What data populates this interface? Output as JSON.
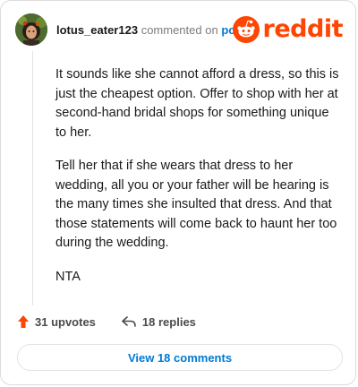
{
  "comment": {
    "username": "lotus_eater123",
    "action_text": "commented on",
    "target_link": "post",
    "paragraphs": [
      "It sounds like she cannot afford a dress, so this is just the cheapest option. Offer to shop with her at second-hand bridal shops for something unique to her.",
      "Tell her that if she wears that dress to her wedding, all you or your father will be hearing is the many times she insulted that dress. And that those statements will come back to haunt her too during the wedding.",
      "NTA"
    ]
  },
  "brand": {
    "wordmark": "reddit",
    "color": "#ff4500"
  },
  "actions": {
    "upvotes_label": "31 upvotes",
    "replies_label": "18 replies"
  },
  "view_button": {
    "label": "View 18 comments"
  },
  "icons": {
    "avatar": "user-avatar",
    "logo": "reddit-snoo-icon",
    "upvote": "upvote-arrow-icon",
    "reply": "reply-arrow-icon"
  },
  "colors": {
    "accent": "#ff4500",
    "link": "#0079d3"
  }
}
